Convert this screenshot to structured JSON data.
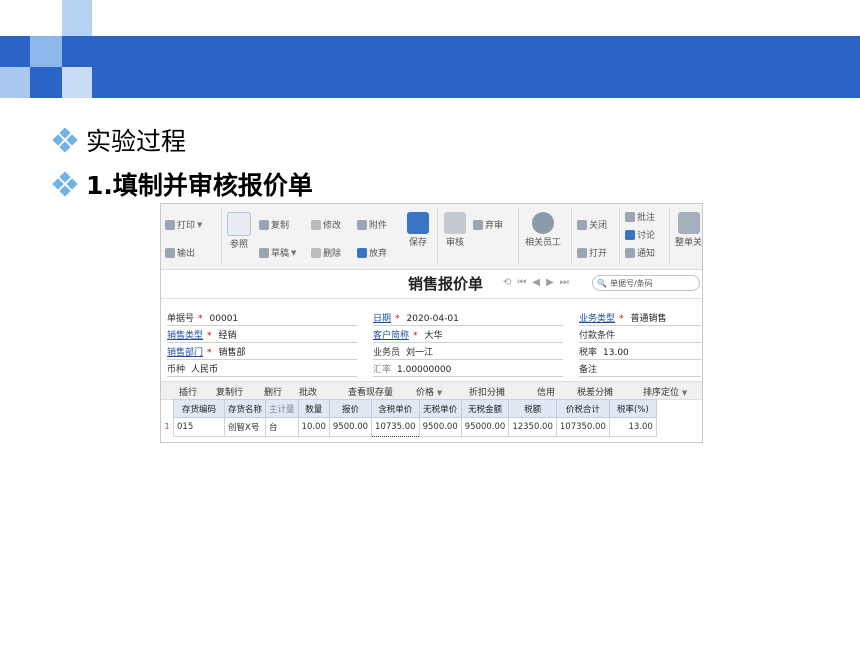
{
  "slide": {
    "bullets": [
      "实验过程",
      "1.填制并审核报价单"
    ]
  },
  "toolbar": {
    "print": "打印",
    "export": "输出",
    "reference": "参照",
    "copy": "复制",
    "draft": "草稿",
    "modify": "修改",
    "delete": "删除",
    "attachment": "附件",
    "abandon": "放弃",
    "save": "保存",
    "audit": "审核",
    "discard_audit": "弃审",
    "related_staff": "相关员工",
    "close": "关闭",
    "open": "打开",
    "annotate": "批注",
    "discuss": "讨论",
    "notify": "通知",
    "whole_order": "整单关"
  },
  "document": {
    "title": "销售报价单",
    "search_placeholder": "单据号/条码"
  },
  "form": {
    "doc_no_label": "单据号",
    "doc_no": "00001",
    "date_label": "日期",
    "date": "2020-04-01",
    "biz_type_label": "业务类型",
    "biz_type": "普通销售",
    "sale_type_label": "销售类型",
    "sale_type": "经销",
    "customer_label": "客户简称",
    "customer": "大华",
    "payment_label": "付款条件",
    "payment": "",
    "dept_label": "销售部门",
    "dept": "销售部",
    "salesman_label": "业务员",
    "salesman": "刘一江",
    "tax_rate_label": "税率",
    "tax_rate": "13.00",
    "currency_label": "币种",
    "currency": "人民币",
    "exchange_label": "汇率",
    "exchange": "1.00000000",
    "remark_label": "备注",
    "remark": ""
  },
  "grid_toolbar": [
    "插行",
    "复制行",
    "删行",
    "批改",
    "查看现存量",
    "价格",
    "折扣分摊",
    "信用",
    "税差分摊",
    "排序定位"
  ],
  "table": {
    "headers": [
      "存货编码",
      "存货名称",
      "主计量",
      "数量",
      "报价",
      "含税单价",
      "无税单价",
      "无税金额",
      "税额",
      "价税合计",
      "税率(%)"
    ],
    "row_number": "1",
    "rows": [
      [
        "015",
        "创智X号",
        "台",
        "10.00",
        "9500.00",
        "10735.00",
        "9500.00",
        "95000.00",
        "12350.00",
        "107350.00",
        "13.00"
      ]
    ]
  }
}
